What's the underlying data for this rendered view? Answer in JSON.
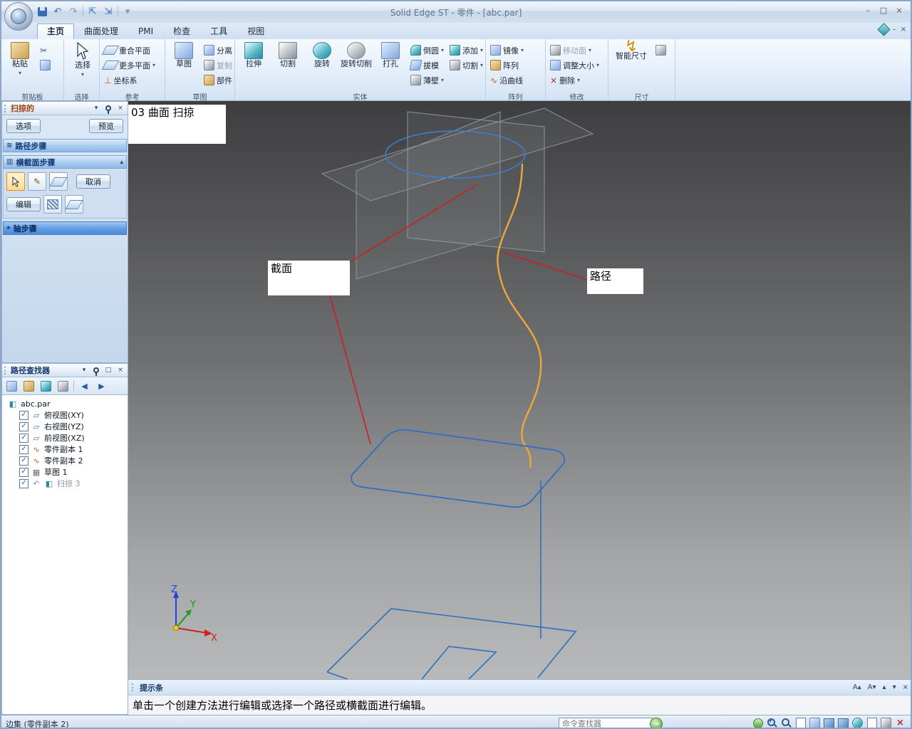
{
  "window": {
    "title": "Solid Edge ST - 零件 - [abc.par]",
    "status_left": "边集 (零件副本 2)",
    "command_finder": "命令查找器"
  },
  "tabs": {
    "home": "主页",
    "surfacing": "曲面处理",
    "pmi": "PMI",
    "inspect": "检查",
    "tools": "工具",
    "view": "视图"
  },
  "ribbon": {
    "clipboard": {
      "paste": "粘贴",
      "group": "剪贴板"
    },
    "select_group": {
      "select": "选择",
      "group": "选择"
    },
    "reference": {
      "coincident_plane": "重合平面",
      "more_planes": "更多平面",
      "coordinate_system": "坐标系",
      "group": "参考"
    },
    "sketch": {
      "sketch": "草图",
      "detach": "分离",
      "copy": "复制",
      "component": "部件",
      "group": "草图"
    },
    "solids": {
      "extrude": "拉伸",
      "cut": "切割",
      "revolve": "旋转",
      "revolved_cut": "旋转切削",
      "hole": "打孔",
      "round": "倒圆",
      "draft": "拔模",
      "thin_wall": "薄壁",
      "add": "添加",
      "cut2": "切割",
      "group": "实体"
    },
    "pattern": {
      "mirror": "镜像",
      "pattern": "阵列",
      "along_curve": "沿曲线",
      "group": "阵列"
    },
    "modify": {
      "move_face": "移动面",
      "resize": "调整大小",
      "delete": "删除",
      "group": "修改"
    },
    "dimension": {
      "smart_dimension": "智能尺寸",
      "group": "尺寸"
    }
  },
  "sweep_panel": {
    "title": "扫掠的",
    "options": "选项",
    "preview": "预览",
    "path_step": "路径步骤",
    "section_step": "横截面步骤",
    "cancel": "取消",
    "edit": "编辑",
    "axis_step": "轴步骤"
  },
  "pathfinder": {
    "title": "路径查找器",
    "root": "abc.par",
    "items": [
      {
        "label": "俯视图(XY)",
        "checked": true
      },
      {
        "label": "右视图(YZ)",
        "checked": true
      },
      {
        "label": "前视图(XZ)",
        "checked": true
      },
      {
        "label": "零件副本 1",
        "checked": true
      },
      {
        "label": "零件副本 2",
        "checked": true
      },
      {
        "label": "草图 1",
        "checked": true
      },
      {
        "label": "扫掠 3",
        "checked": true
      }
    ]
  },
  "viewport": {
    "info_label": "03 曲面 扫掠",
    "section_label": "截面",
    "path_label": "路径",
    "triad": {
      "x": "X",
      "y": "Y",
      "z": "Z"
    }
  },
  "prompt": {
    "title": "提示条",
    "message": "单击一个创建方法进行编辑或选择一个路径或横截面进行编辑。"
  },
  "icons": {
    "dropdown": "▾",
    "collapse": "▴",
    "close": "×",
    "minimize": "–",
    "maximize": "□",
    "back": "◀",
    "forward": "▶",
    "undo": "↶",
    "redo": "↷",
    "cut": "✂",
    "check": "✓",
    "pencil": "✎",
    "wave": "∿",
    "plane": "▱",
    "bolt": "↯",
    "go": "→",
    "font_increase": "A▴",
    "font_decrease": "A▾"
  },
  "colors": {
    "path_orange": "#f0a73a",
    "wire_blue": "#2f6fbf",
    "leader_red": "#cc2020"
  }
}
